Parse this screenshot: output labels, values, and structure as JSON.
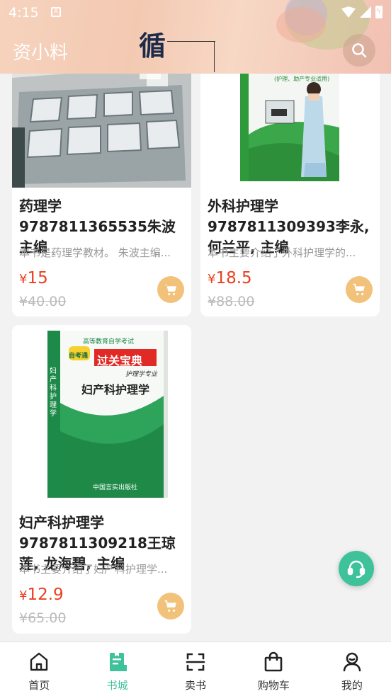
{
  "status_bar": {
    "time": "4:15"
  },
  "header": {
    "app_title": "资小料",
    "logo_char": "循"
  },
  "books": [
    {
      "title": "药理学9787811365535朱波主编",
      "desc": "本书是药理学教材。 朱波主编...",
      "price": "15",
      "old_price": "¥40.00",
      "currency": "¥"
    },
    {
      "title": "外科护理学9787811309393李永, 何兰平, 主编",
      "desc": "本书主要介绍了外科护理学的...",
      "price": "18.5",
      "old_price": "¥88.00",
      "currency": "¥"
    },
    {
      "title": "妇产科护理学9787811309218王琼莲, 龙海碧, 主编",
      "desc": "本书主要介绍了妇产科护理学...",
      "price": "12.9",
      "old_price": "¥65.00",
      "currency": "¥"
    }
  ],
  "book3_cover": {
    "series": "高等教育自学考试",
    "brand": "自考通",
    "headline": "过关宝典",
    "major": "护理学专业",
    "subject": "妇产科护理学",
    "spine": "妇产科护理学",
    "publisher": "中国言实出版社"
  },
  "book2_cover": {
    "subtitle": "(护理、助产专业适用)"
  },
  "nav": {
    "items": [
      {
        "label": "首页",
        "icon": "home-icon",
        "active": false
      },
      {
        "label": "书城",
        "icon": "bookstore-icon",
        "active": true
      },
      {
        "label": "卖书",
        "icon": "scan-icon",
        "active": false
      },
      {
        "label": "购物车",
        "icon": "shopping-bag-icon",
        "active": false
      },
      {
        "label": "我的",
        "icon": "profile-icon",
        "active": false
      }
    ]
  },
  "colors": {
    "accent": "#3ec29a",
    "price": "#e8401f",
    "cart_button": "#f2c27a"
  }
}
